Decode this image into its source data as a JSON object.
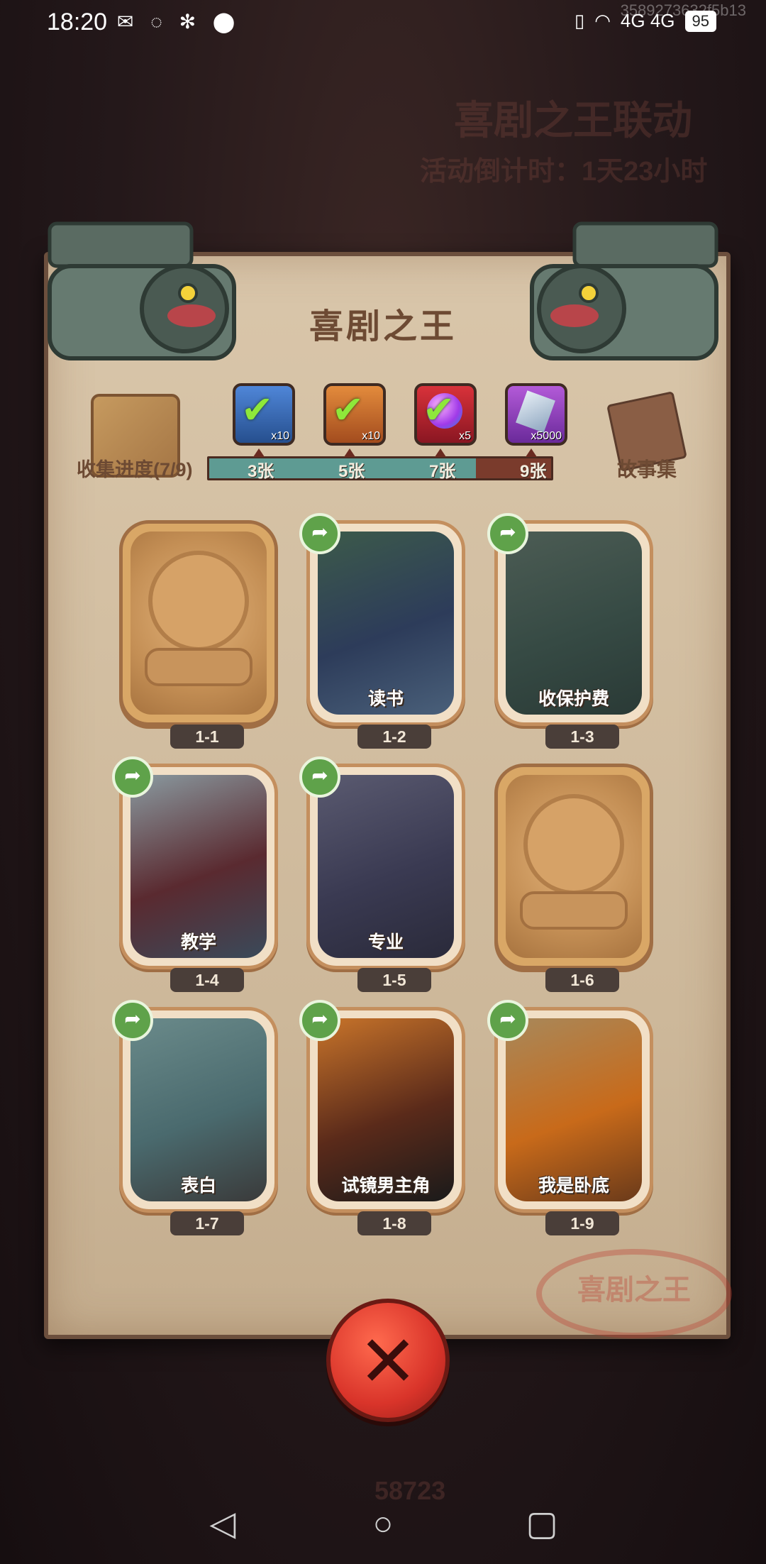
{
  "status_bar": {
    "time": "18:20",
    "left_icons": "✉ ◌ ✻ ⬤",
    "network": "4G 4G",
    "battery": "95",
    "device_id": "3589273632f5b13"
  },
  "background": {
    "event_title": "喜剧之王联动",
    "event_countdown": "活动倒计时：1天23小时",
    "coins": "58723"
  },
  "panel": {
    "title": "喜剧之王",
    "collection_progress": "收集进度(7/9)",
    "story_label": "故事集"
  },
  "rewards": [
    {
      "count": "x10",
      "claimed": true
    },
    {
      "count": "x10",
      "claimed": true
    },
    {
      "count": "x5",
      "claimed": true
    },
    {
      "count": "x5000",
      "claimed": false
    }
  ],
  "progress": {
    "fraction": 0.78,
    "ticks": [
      "3张",
      "5张",
      "7张",
      "9张"
    ]
  },
  "cards": [
    {
      "id": "1-1",
      "title": "",
      "locked": true
    },
    {
      "id": "1-2",
      "title": "读书",
      "locked": false
    },
    {
      "id": "1-3",
      "title": "收保护费",
      "locked": false
    },
    {
      "id": "1-4",
      "title": "教学",
      "locked": false
    },
    {
      "id": "1-5",
      "title": "专业",
      "locked": false
    },
    {
      "id": "1-6",
      "title": "",
      "locked": true
    },
    {
      "id": "1-7",
      "title": "表白",
      "locked": false
    },
    {
      "id": "1-8",
      "title": "试镜男主角",
      "locked": false
    },
    {
      "id": "1-9",
      "title": "我是卧底",
      "locked": false
    }
  ],
  "stamp_text": "喜剧之王",
  "colors": {
    "parchment": "#d9c6aa",
    "progress_fill": "#5e9b93",
    "close_button": "#d9342a"
  }
}
